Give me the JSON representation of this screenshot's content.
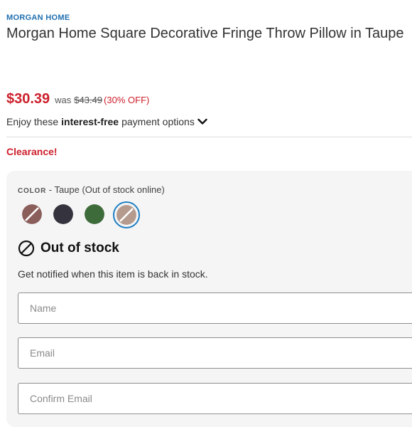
{
  "product": {
    "brand": "MORGAN HOME",
    "title": "Morgan Home Square Decorative Fringe Throw Pillow in Taupe"
  },
  "pricing": {
    "price": "$30.39",
    "was_label": "was",
    "was_price": "$43.49",
    "discount": "(30% OFF)"
  },
  "payment": {
    "prefix": "Enjoy these",
    "highlight": "interest-free",
    "suffix": "payment options",
    "icon": "chevron-down-icon"
  },
  "badge": {
    "clearance": "Clearance!"
  },
  "color": {
    "label": "COLOR",
    "selected_text": "- Taupe (Out of stock online)",
    "swatches": [
      {
        "name": "mauve",
        "color": "#8a5e5b",
        "unavailable": true
      },
      {
        "name": "charcoal",
        "color": "#35333d",
        "unavailable": false
      },
      {
        "name": "green",
        "color": "#3d6b3a",
        "unavailable": false
      },
      {
        "name": "taupe",
        "color": "#b59b8e",
        "unavailable": true,
        "selected": true
      }
    ]
  },
  "stock": {
    "status": "Out of stock",
    "icon": "unavailable-icon",
    "notify_text": "Get notified when this item is back in stock."
  },
  "form": {
    "name_placeholder": "Name",
    "email_placeholder": "Email",
    "confirm_email_placeholder": "Confirm Email"
  },
  "colors": {
    "price_red": "#cc1f2b",
    "brand_blue": "#1f6fb0",
    "selected_ring": "#1f7fc4"
  }
}
